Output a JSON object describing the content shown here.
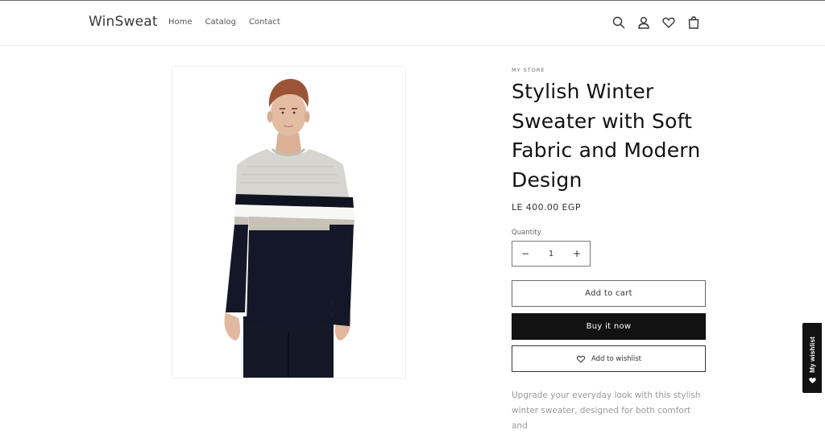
{
  "header": {
    "logo": "WinSweat",
    "nav": [
      "Home",
      "Catalog",
      "Contact"
    ],
    "icons": [
      "search-icon",
      "account-icon",
      "heart-icon",
      "cart-icon"
    ]
  },
  "product": {
    "vendor": "MY STORE",
    "title": "Stylish Winter Sweater with Soft Fabric and Modern Design",
    "price": "LE 400.00 EGP",
    "quantity_label": "Quantity",
    "quantity_value": "1",
    "add_to_cart": "Add to cart",
    "buy_now": "Buy it now",
    "add_to_wishlist": "Add to wishlist",
    "description": "Upgrade your everyday look with this stylish winter sweater, designed for both comfort and"
  },
  "wishlist_tab": {
    "label": "My wishlist"
  },
  "colors": {
    "primary": "#121212",
    "muted": "#9a9a9a",
    "sweater_light": "#d7d5cf",
    "sweater_dark": "#131727"
  }
}
